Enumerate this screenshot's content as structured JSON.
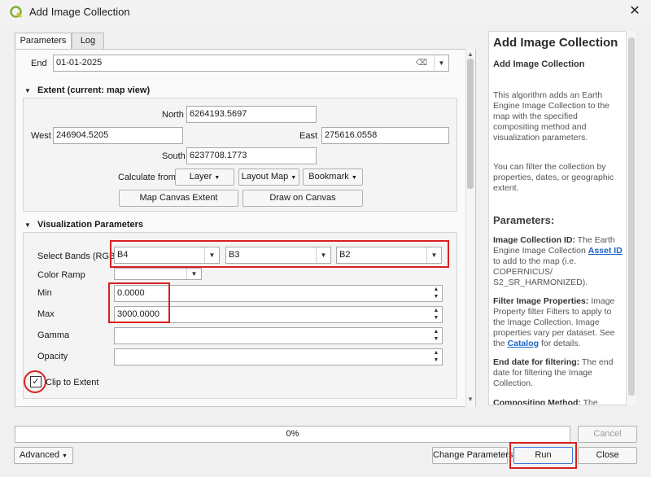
{
  "window": {
    "title": "Add Image Collection"
  },
  "tabs": [
    {
      "label": "Parameters"
    },
    {
      "label": "Log"
    }
  ],
  "end": {
    "label": "End",
    "value": "01-01-2025"
  },
  "extent": {
    "title": "Extent (current: map view)",
    "north_label": "North",
    "north": "6264193.5697",
    "west_label": "West",
    "west": "246904.5205",
    "east_label": "East",
    "east": "275616.0558",
    "south_label": "South",
    "south": "6237708.1773",
    "calc_label": "Calculate from",
    "layer_btn": "Layer",
    "layout_btn": "Layout Map",
    "bookmark_btn": "Bookmark",
    "map_canvas_btn": "Map Canvas Extent",
    "draw_btn": "Draw on Canvas"
  },
  "vis": {
    "title": "Visualization Parameters",
    "bands_label": "Select Bands (RGB)",
    "band1": "B4",
    "band2": "B3",
    "band3": "B2",
    "ramp_label": "Color Ramp",
    "min_label": "Min",
    "min": "0.0000",
    "max_label": "Max",
    "max": "3000.0000",
    "gamma_label": "Gamma",
    "opacity_label": "Opacity",
    "clip_label": "Clip to Extent"
  },
  "help": {
    "h1": "Add Image Collection",
    "sub": "Add Image Collection",
    "p1": "This algorithm adds an Earth Engine Image Collection to the map with the specified compositing method and visualization parameters.",
    "p2": "You can filter the collection by properties, dates, or geographic extent.",
    "params_title": "Parameters:",
    "ic_b": "Image Collection ID:",
    "ic_t1": " The Earth Engine Image Collection ",
    "ic_link": "Asset ID",
    "ic_t2": " to add to the map (i.e. COPERNICUS/ S2_SR_HARMONIZED).",
    "fp_b": "Filter Image Properties:",
    "fp_t1": " Image Property filter Filters to apply to the Image Collection. Image properties vary per dataset. See the ",
    "fp_link": "Catalog",
    "fp_t2": " for details.",
    "ed_b": "End date for filtering:",
    "ed_t": " The end date for filtering the Image Collection.",
    "cm_b": "Compositing Method:",
    "cm_t": " The"
  },
  "footer": {
    "progress": "0%",
    "cancel": "Cancel",
    "advanced": "Advanced",
    "change_params": "Change Parameters",
    "run": "Run",
    "close": "Close"
  }
}
